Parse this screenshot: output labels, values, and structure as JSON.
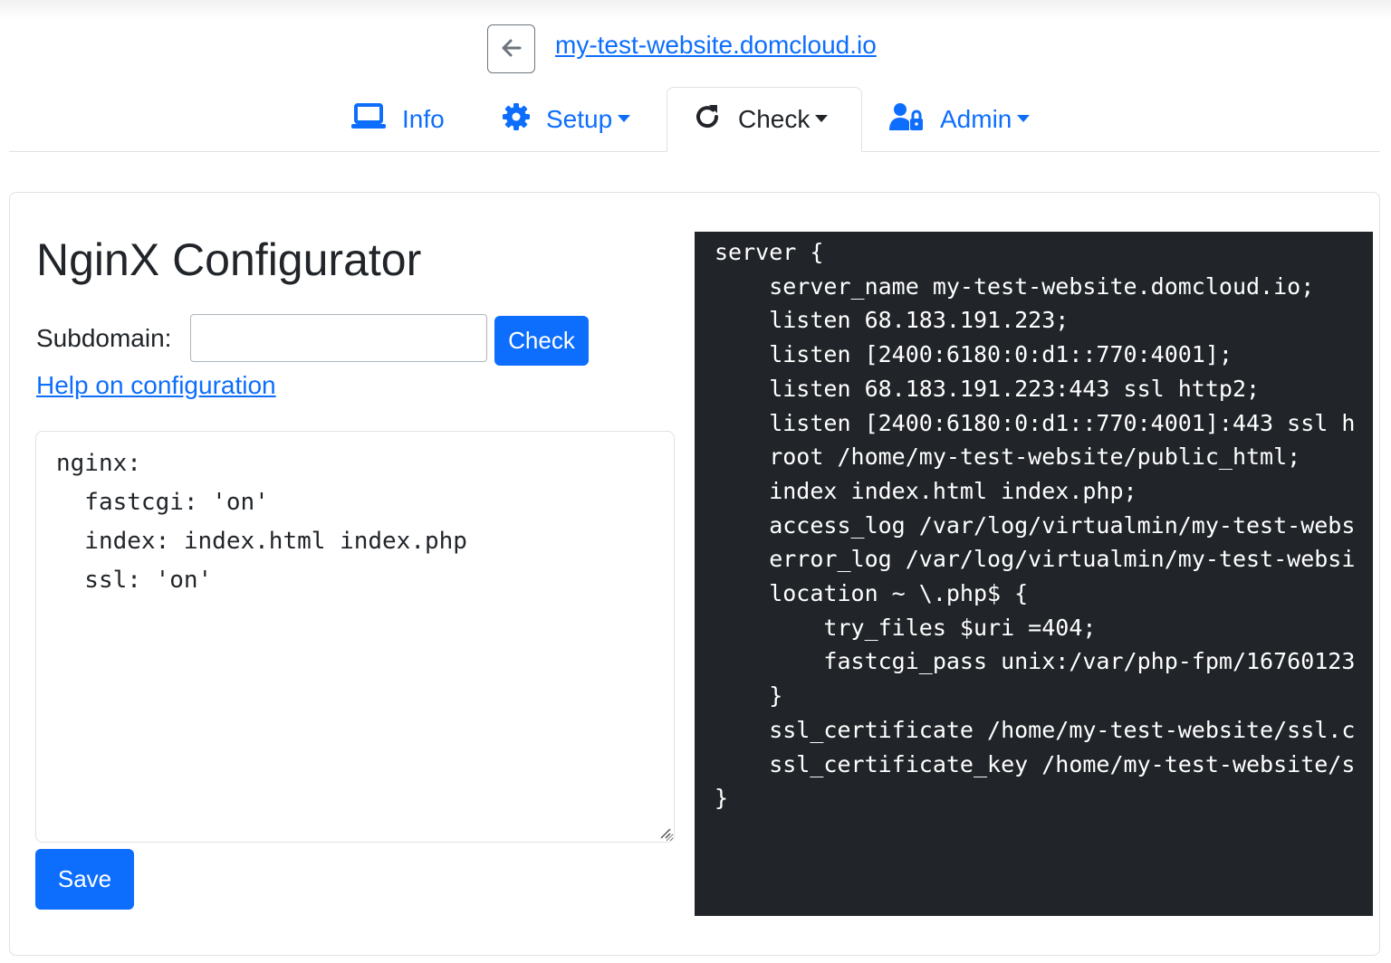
{
  "header": {
    "site_name": "my-test-website.domcloud.io"
  },
  "nav": {
    "tabs": [
      {
        "label": "Info",
        "icon": "laptop-icon",
        "active": false,
        "dropdown": false
      },
      {
        "label": "Setup",
        "icon": "gear-icon",
        "active": false,
        "dropdown": true
      },
      {
        "label": "Check",
        "icon": "refresh-icon",
        "active": true,
        "dropdown": true
      },
      {
        "label": "Admin",
        "icon": "user-lock-icon",
        "active": false,
        "dropdown": true
      }
    ]
  },
  "main": {
    "title": "NginX Configurator",
    "subdomain_label": "Subdomain:",
    "subdomain_value": "",
    "check_button": "Check",
    "help_link": "Help on configuration",
    "yaml_config": "nginx:\n  fastcgi: 'on'\n  index: index.html index.php\n  ssl: 'on'",
    "save_button": "Save"
  },
  "output": {
    "lines": [
      "server {",
      "    server_name my-test-website.domcloud.io;",
      "    listen 68.183.191.223;",
      "    listen [2400:6180:0:d1::770:4001];",
      "    listen 68.183.191.223:443 ssl http2;",
      "    listen [2400:6180:0:d1::770:4001]:443 ssl h",
      "    root /home/my-test-website/public_html;",
      "    index index.html index.php;",
      "    access_log /var/log/virtualmin/my-test-webs",
      "    error_log /var/log/virtualmin/my-test-websi",
      "    location ~ \\.php$ {",
      "        try_files $uri =404;",
      "        fastcgi_pass unix:/var/php-fpm/16760123",
      "    }",
      "    ssl_certificate /home/my-test-website/ssl.c",
      "    ssl_certificate_key /home/my-test-website/s",
      "}"
    ]
  },
  "colors": {
    "primary": "#0d6efd",
    "code_background": "#212529",
    "text": "#212529"
  }
}
